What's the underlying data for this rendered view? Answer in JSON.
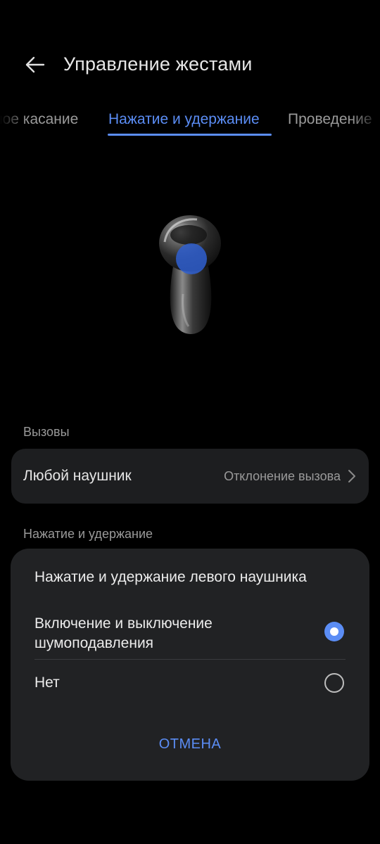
{
  "header": {
    "title": "Управление жестами"
  },
  "tabs": [
    {
      "label": "ное касание"
    },
    {
      "label": "Нажатие и удержание"
    },
    {
      "label": "Проведение"
    }
  ],
  "sections": {
    "calls_label": "Вызовы",
    "hold_label": "Нажатие и удержание"
  },
  "calls_card": {
    "label": "Любой наушник",
    "value": "Отклонение вызова"
  },
  "dialog": {
    "title": "Нажатие и удержание левого наушника",
    "options": [
      {
        "label": "Включение и выключение шумоподавления",
        "selected": true
      },
      {
        "label": "Нет",
        "selected": false
      }
    ],
    "cancel_label": "ОТМЕНА"
  },
  "colors": {
    "accent": "#5b8df5",
    "background": "#000000",
    "card": "#1d1e20",
    "dialog": "#212224"
  }
}
